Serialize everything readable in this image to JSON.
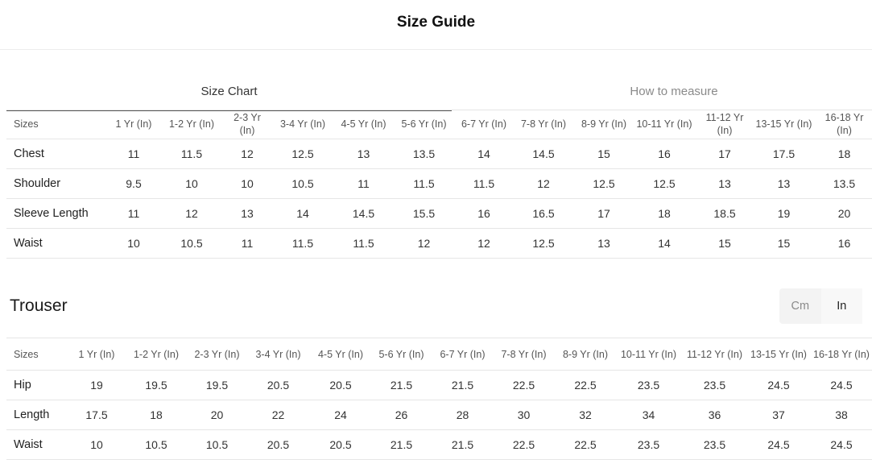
{
  "header": {
    "title": "Size Guide"
  },
  "tabs": [
    {
      "label": "Size Chart",
      "active": true
    },
    {
      "label": "How to measure",
      "active": false
    }
  ],
  "shirt": {
    "headers": [
      "Sizes",
      "1 Yr (In)",
      "1-2 Yr (In)",
      "2-3 Yr (In)",
      "3-4 Yr (In)",
      "4-5 Yr (In)",
      "5-6 Yr (In)",
      "6-7 Yr (In)",
      "7-8 Yr (In)",
      "8-9 Yr (In)",
      "10-11 Yr (In)",
      "11-12 Yr (In)",
      "13-15 Yr (In)",
      "16-18 Yr (In)"
    ],
    "rows": [
      [
        "Chest",
        "11",
        "11.5",
        "12",
        "12.5",
        "13",
        "13.5",
        "14",
        "14.5",
        "15",
        "16",
        "17",
        "17.5",
        "18"
      ],
      [
        "Shoulder",
        "9.5",
        "10",
        "10",
        "10.5",
        "11",
        "11.5",
        "11.5",
        "12",
        "12.5",
        "12.5",
        "13",
        "13",
        "13.5"
      ],
      [
        "Sleeve Length",
        "11",
        "12",
        "13",
        "14",
        "14.5",
        "15.5",
        "16",
        "16.5",
        "17",
        "18",
        "18.5",
        "19",
        "20"
      ],
      [
        "Waist",
        "10",
        "10.5",
        "11",
        "11.5",
        "11.5",
        "12",
        "12",
        "12.5",
        "13",
        "14",
        "15",
        "15",
        "16"
      ]
    ]
  },
  "trouser": {
    "title": "Trouser",
    "units": {
      "cm": "Cm",
      "in": "In",
      "selected": "In"
    },
    "headers": [
      "Sizes",
      "1 Yr (In)",
      "1-2 Yr (In)",
      "2-3 Yr (In)",
      "3-4 Yr (In)",
      "4-5 Yr (In)",
      "5-6 Yr (In)",
      "6-7 Yr (In)",
      "7-8 Yr (In)",
      "8-9 Yr (In)",
      "10-11 Yr (In)",
      "11-12 Yr (In)",
      "13-15 Yr (In)",
      "16-18 Yr (In)"
    ],
    "rows": [
      [
        "Hip",
        "19",
        "19.5",
        "19.5",
        "20.5",
        "20.5",
        "21.5",
        "21.5",
        "22.5",
        "22.5",
        "23.5",
        "23.5",
        "24.5",
        "24.5"
      ],
      [
        "Length",
        "17.5",
        "18",
        "20",
        "22",
        "24",
        "26",
        "28",
        "30",
        "32",
        "34",
        "36",
        "37",
        "38"
      ],
      [
        "Waist",
        "10",
        "10.5",
        "10.5",
        "20.5",
        "20.5",
        "21.5",
        "21.5",
        "22.5",
        "22.5",
        "23.5",
        "23.5",
        "24.5",
        "24.5"
      ]
    ]
  }
}
